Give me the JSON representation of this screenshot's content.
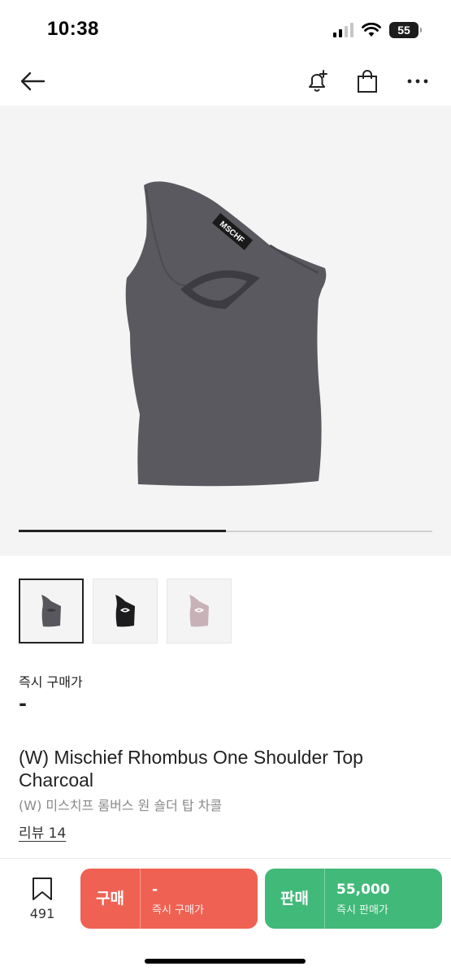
{
  "status_bar": {
    "time": "10:38",
    "battery": "55"
  },
  "product": {
    "image_alt": "One shoulder top charcoal",
    "thumbnails": [
      {
        "name": "charcoal",
        "color": "#58575d"
      },
      {
        "name": "black",
        "color": "#1c1c1e"
      },
      {
        "name": "pink",
        "color": "#c9b2b7"
      }
    ],
    "price_label": "즉시 구매가",
    "price_value": "-",
    "title_en": "(W) Mischief Rhombus One Shoulder Top Charcoal",
    "title_ko": "(W) 미스치프 롬버스 원 숄더 탑 차콜",
    "review_link": "리뷰 14",
    "brand_tag": "MSCHF",
    "gallery_progress": 0.5
  },
  "bottom_bar": {
    "wish_count": "491",
    "buy": {
      "label": "구매",
      "price": "-",
      "sub": "즉시 구매가"
    },
    "sell": {
      "label": "판매",
      "price": "55,000",
      "sub": "즉시 판매가"
    }
  },
  "colors": {
    "buy": "#ef6253",
    "sell": "#41b979"
  }
}
